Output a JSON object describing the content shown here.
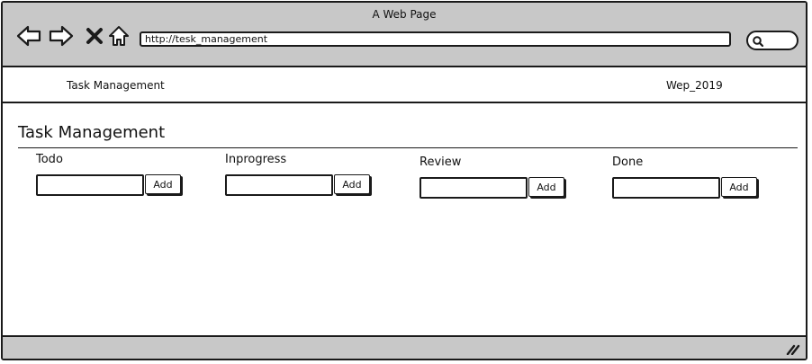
{
  "window": {
    "title": "A Web Page"
  },
  "browser": {
    "url": "http://tesk_management",
    "icons": {
      "back": "back-arrow-icon",
      "forward": "forward-arrow-icon",
      "stop": "close-x-icon",
      "home": "home-icon",
      "search": "search-icon",
      "resize": "resize-grip-icon"
    }
  },
  "nav": {
    "brand": "Task Management",
    "right_label": "Wep_2019"
  },
  "page": {
    "heading": "Task Management"
  },
  "columns": [
    {
      "title": "Todo",
      "input_value": "",
      "add_label": "Add"
    },
    {
      "title": "Inprogress",
      "input_value": "",
      "add_label": "Add"
    },
    {
      "title": "Review",
      "input_value": "",
      "add_label": "Add"
    },
    {
      "title": "Done",
      "input_value": "",
      "add_label": "Add"
    }
  ],
  "colors": {
    "chrome": "#c8c8c8",
    "outline": "#1a1a1a",
    "background": "#ffffff"
  }
}
